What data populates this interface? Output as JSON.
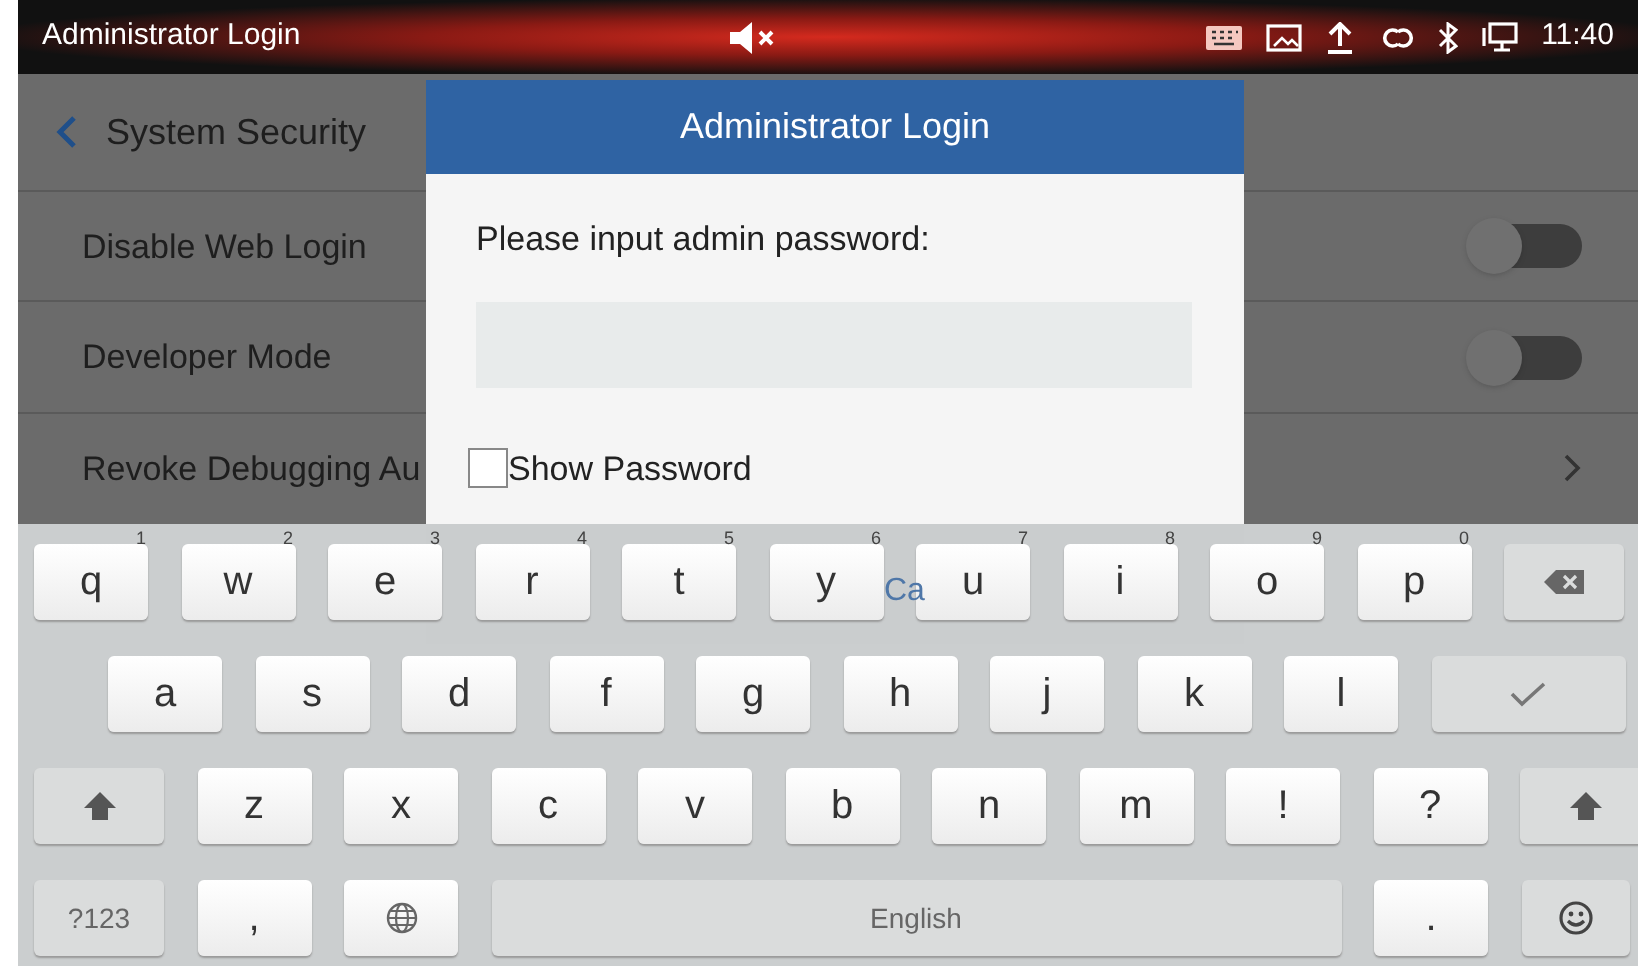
{
  "status_bar": {
    "title": "Administrator Login",
    "muted": true,
    "time": "11:40"
  },
  "page": {
    "title": "System Security",
    "rows": [
      {
        "label": "Disable Web Login",
        "kind": "toggle",
        "on": false
      },
      {
        "label": "Developer Mode",
        "kind": "toggle",
        "on": false
      },
      {
        "label": "Revoke Debugging Au",
        "kind": "link"
      }
    ]
  },
  "dialog": {
    "title": "Administrator Login",
    "prompt": "Please input admin password:",
    "show_password": {
      "label": "Show Password",
      "checked": false
    },
    "cancel_label": "Ca"
  },
  "keyboard": {
    "rows": [
      {
        "keys": [
          {
            "kind": "char",
            "label": "q",
            "hint": "1"
          },
          {
            "kind": "char",
            "label": "w",
            "hint": "2"
          },
          {
            "kind": "char",
            "label": "e",
            "hint": "3"
          },
          {
            "kind": "char",
            "label": "r",
            "hint": "4"
          },
          {
            "kind": "char",
            "label": "t",
            "hint": "5"
          },
          {
            "kind": "char",
            "label": "y",
            "hint": "6"
          },
          {
            "kind": "char",
            "label": "u",
            "hint": "7"
          },
          {
            "kind": "char",
            "label": "i",
            "hint": "8"
          },
          {
            "kind": "char",
            "label": "o",
            "hint": "9"
          },
          {
            "kind": "char",
            "label": "p",
            "hint": "0"
          },
          {
            "kind": "backspace"
          }
        ]
      },
      {
        "keys": [
          {
            "kind": "char",
            "label": "a"
          },
          {
            "kind": "char",
            "label": "s"
          },
          {
            "kind": "char",
            "label": "d"
          },
          {
            "kind": "char",
            "label": "f"
          },
          {
            "kind": "char",
            "label": "g"
          },
          {
            "kind": "char",
            "label": "h"
          },
          {
            "kind": "char",
            "label": "j"
          },
          {
            "kind": "char",
            "label": "k"
          },
          {
            "kind": "char",
            "label": "l"
          },
          {
            "kind": "enter"
          }
        ]
      },
      {
        "keys": [
          {
            "kind": "shift"
          },
          {
            "kind": "char",
            "label": "z"
          },
          {
            "kind": "char",
            "label": "x"
          },
          {
            "kind": "char",
            "label": "c"
          },
          {
            "kind": "char",
            "label": "v"
          },
          {
            "kind": "char",
            "label": "b"
          },
          {
            "kind": "char",
            "label": "n"
          },
          {
            "kind": "char",
            "label": "m"
          },
          {
            "kind": "char",
            "label": "!"
          },
          {
            "kind": "char",
            "label": "?"
          },
          {
            "kind": "shift"
          }
        ]
      },
      {
        "keys": [
          {
            "kind": "symbols",
            "label": "?123"
          },
          {
            "kind": "char",
            "label": ","
          },
          {
            "kind": "globe"
          },
          {
            "kind": "space",
            "label": "English"
          },
          {
            "kind": "char",
            "label": "."
          },
          {
            "kind": "emoji"
          }
        ]
      }
    ]
  }
}
